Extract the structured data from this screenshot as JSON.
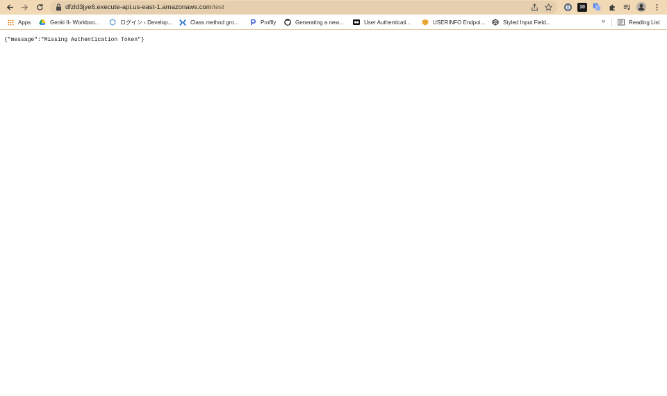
{
  "browser": {
    "url_host": "dfzld3jye6.execute-api.us-east-1.amazonaws.com",
    "url_path": "/test",
    "extension_badge": "10",
    "accent_color": "#f1d9b5"
  },
  "bookmarks": [
    {
      "label": "Apps",
      "icon": "apps-grid-icon"
    },
    {
      "label": "Genki II- Workboo...",
      "icon": "google-drive-icon"
    },
    {
      "label": "ログイン ‹ Develop...",
      "icon": "hexagon-icon"
    },
    {
      "label": "Class method gro...",
      "icon": "class-method-icon"
    },
    {
      "label": "Proflly",
      "icon": "proflly-icon"
    },
    {
      "label": "Generating a new...",
      "icon": "github-icon"
    },
    {
      "label": "User Authenticati...",
      "icon": "media-icon"
    },
    {
      "label": "USERINFO Endpoi...",
      "icon": "cube-icon"
    },
    {
      "label": "Styled Input Field...",
      "icon": "codepen-icon"
    }
  ],
  "bookmarks_more": "»",
  "reading_list": "Reading List",
  "page": {
    "body_text": "{\"message\":\"Missing Authentication Token\"}"
  }
}
